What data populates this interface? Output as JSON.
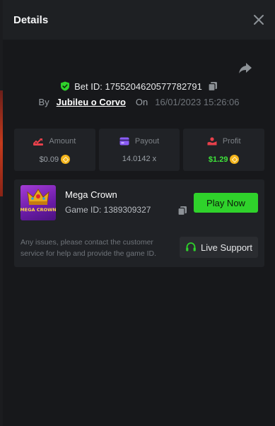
{
  "modal": {
    "title": "Details"
  },
  "bet": {
    "id_label": "Bet ID: 1755204620577782791",
    "by_label": "By",
    "user": "Jubileu o Corvo",
    "on_label": "On",
    "date": "16/01/2023 15:26:06"
  },
  "stats": [
    {
      "label": "Amount",
      "value": "$0.09",
      "icon": "amount-icon"
    },
    {
      "label": "Payout",
      "value": "14.0142 x",
      "icon": "payout-icon"
    },
    {
      "label": "Profit",
      "value": "$1.29",
      "icon": "profit-icon"
    }
  ],
  "game": {
    "name": "Mega Crown",
    "id_label": "Game ID: 1389309327",
    "thumb_title": "MEGA CROWN",
    "play_label": "Play Now",
    "note": "Any issues, please contact the customer service for help and provide the game ID.",
    "support_label": "Live Support"
  },
  "colors": {
    "accent_green": "#2fd22b",
    "profit_green": "#3ee43a",
    "amount_red": "#e8404b",
    "payout_purple": "#8b5cf6",
    "coin_gold": "#f3b31a"
  }
}
